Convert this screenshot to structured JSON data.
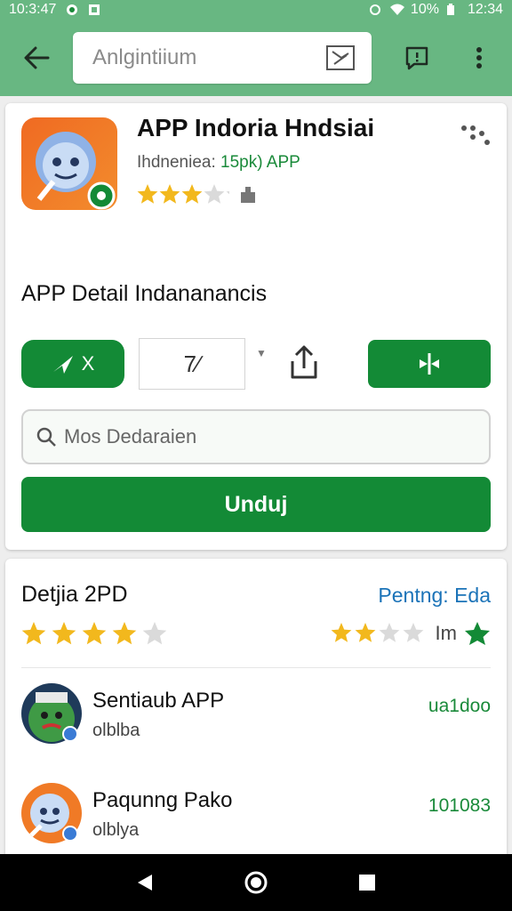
{
  "status_bar": {
    "time_left": "10:3:47",
    "battery": "10%",
    "time_right": "12:34"
  },
  "app_bar": {
    "search_placeholder": "Anlgintiium"
  },
  "app": {
    "title": "APP Indoria Hndsiai",
    "subtitle_prefix": "Ihdneniea:",
    "subtitle_accent": "15pk) APP",
    "rating_stars": 3,
    "max_stars": 5
  },
  "detail": {
    "title": "APP Detail Indananancis"
  },
  "actions": {
    "pill_label": "X",
    "outline_label": "7∕",
    "search_placeholder": "Mos Dedaraien",
    "install_label": "Unduj"
  },
  "reviews": {
    "title": "Detjia 2PD",
    "link": "Pentng: Eda",
    "left_stars": 4,
    "right_label": "Im",
    "right_stars": 2,
    "items": [
      {
        "name": "Sentiaub APP",
        "meta": "olblba",
        "value": "ua1doo"
      },
      {
        "name": "Paqunng Pako",
        "meta": "olblya",
        "value": "101083"
      }
    ]
  },
  "colors": {
    "brand_green": "#68b782",
    "action_green": "#138a36",
    "link_blue": "#1b73b8",
    "star_gold": "#f2b81d"
  }
}
